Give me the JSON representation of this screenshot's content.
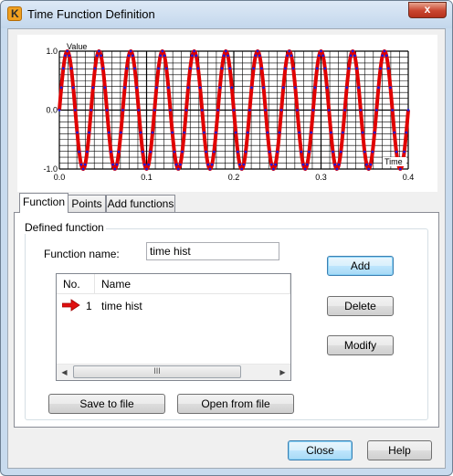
{
  "window": {
    "title": "Time Function Definition",
    "close_glyph": "x"
  },
  "chart_data": {
    "type": "line",
    "title": "",
    "xlabel": "Time",
    "ylabel": "Value",
    "xlim": [
      0.0,
      0.4
    ],
    "ylim": [
      -1.0,
      1.0
    ],
    "x_ticks": [
      "0.0",
      "0.1",
      "0.2",
      "0.3",
      "0.4"
    ],
    "y_ticks": [
      "1.0",
      "0.0",
      "-1.0"
    ],
    "grid": true,
    "function": "sine",
    "amplitude": 1.0,
    "cycles": 11,
    "series": [
      {
        "color": "#e00000",
        "style": "line"
      },
      {
        "color": "#1a1adb",
        "style": "markers"
      }
    ]
  },
  "tabs": [
    {
      "label": "Function",
      "active": true
    },
    {
      "label": "Points",
      "active": false
    },
    {
      "label": "Add functions",
      "active": false
    }
  ],
  "defined_function": {
    "group_label": "Defined function",
    "name_label": "Function name:",
    "name_value": "time hist"
  },
  "list": {
    "columns": [
      "No.",
      "Name"
    ],
    "rows": [
      {
        "no": "1",
        "name": "time hist",
        "selected_indicator": "arrow-right"
      }
    ],
    "scroll_grip": "III",
    "scroll_left_glyph": "◀",
    "scroll_right_glyph": "▶"
  },
  "buttons": {
    "add": "Add",
    "delete": "Delete",
    "modify": "Modify",
    "save": "Save to file",
    "open": "Open from file",
    "close": "Close",
    "help": "Help"
  }
}
